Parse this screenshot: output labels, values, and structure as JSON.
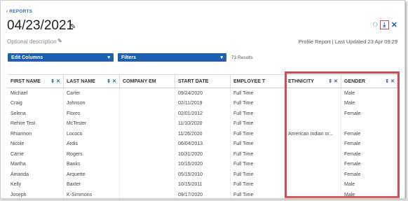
{
  "nav": {
    "back_label": "‹ REPORTS"
  },
  "header": {
    "title": "04/23/2021",
    "description": "Optional description",
    "meta": "Profile Report | Last Updated 23 Apr 09:29"
  },
  "toolbar": {
    "edit_columns_label": "Edit Columns",
    "filters_label": "Filters",
    "results_text": "73 Results",
    "caret": "▾"
  },
  "icons": {
    "pencil": "✎",
    "ghost": "⭘",
    "download": "⤓",
    "close": "✕",
    "sort": "⇕",
    "x": "✕"
  },
  "table": {
    "columns": [
      "FIRST NAME",
      "LAST NAME",
      "COMPANY EM",
      "START DATE",
      "EMPLOYEE T",
      "ETHNICITY",
      "GENDER"
    ],
    "rows": [
      [
        "Michael",
        "Carter",
        "",
        "09/24/2020",
        "Full Time",
        "",
        "Male"
      ],
      [
        "Craig",
        "Johnson",
        "",
        "02/11/2019",
        "Full Time",
        "",
        "Male"
      ],
      [
        "Selena",
        "Flores",
        "",
        "02/01/2012",
        "Full Time",
        "",
        "Female"
      ],
      [
        "Rehire Test",
        "McTester",
        "",
        "11/10/2020",
        "Full Time",
        "",
        ""
      ],
      [
        "Rhiannon",
        "Lococo",
        "",
        "11/26/2020",
        "Full Time",
        "American Indian or...",
        "Female"
      ],
      [
        "Nicole",
        "Ardis",
        "",
        "06/04/2013",
        "Full Time",
        "",
        "Female"
      ],
      [
        "Carrie",
        "Rogers",
        "",
        "10/31/2020",
        "Full Time",
        "",
        "Female"
      ],
      [
        "Martha",
        "Banks",
        "",
        "10/15/2020",
        "Full Time",
        "",
        "Female"
      ],
      [
        "Amanda",
        "Arquette",
        "",
        "05/15/2010",
        "Full Time",
        "",
        "Female"
      ],
      [
        "Kelly",
        "Baxter",
        "",
        "10/15/2011",
        "Full Time",
        "",
        "Male"
      ],
      [
        "Joseph",
        "K-Simmons",
        "",
        "09/17/2020",
        "Full Time",
        "",
        "Male"
      ]
    ]
  },
  "colors": {
    "accent": "#1f5fb0",
    "highlight": "#d44c52"
  }
}
